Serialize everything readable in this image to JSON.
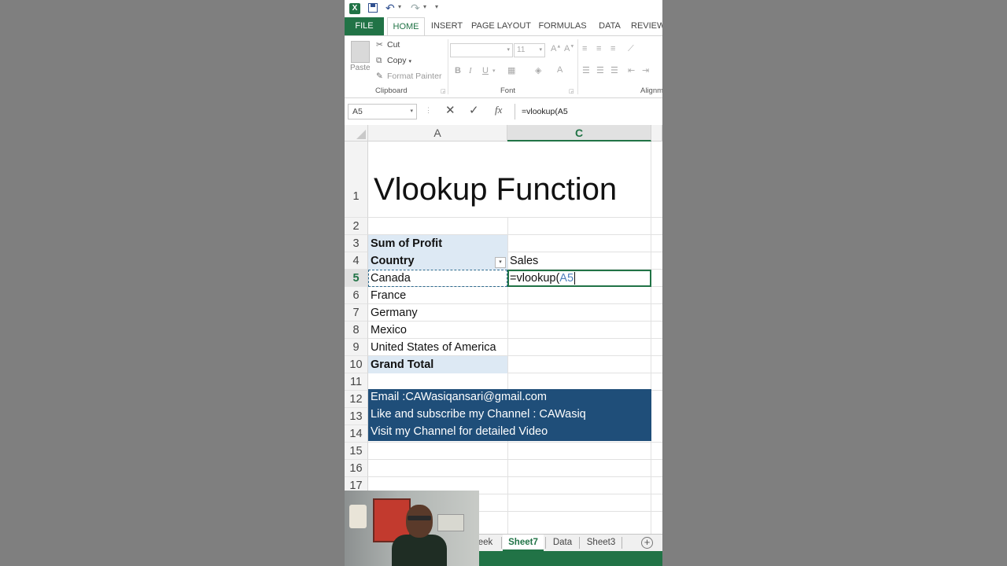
{
  "qat": {
    "app_icon": "X"
  },
  "ribbon_tabs": [
    "FILE",
    "HOME",
    "INSERT",
    "PAGE LAYOUT",
    "FORMULAS",
    "DATA",
    "REVIEW"
  ],
  "clipboard": {
    "paste": "Paste",
    "cut": "Cut",
    "copy": "Copy",
    "format_painter": "Format Painter",
    "label": "Clipboard"
  },
  "font_group": {
    "size": "11",
    "label": "Font"
  },
  "alignment_group": {
    "label": "Alignment"
  },
  "formula_bar": {
    "name_box": "A5",
    "formula": "=vlookup(A5"
  },
  "columns": [
    "A",
    "C"
  ],
  "rows": [
    "1",
    "2",
    "3",
    "4",
    "5",
    "6",
    "7",
    "8",
    "9",
    "10",
    "11",
    "12",
    "13",
    "14",
    "15",
    "16",
    "17"
  ],
  "cells": {
    "title": "Vlookup Function",
    "a3": "Sum of Profit",
    "a4": "Country",
    "c4": "Sales",
    "a5": "Canada",
    "c5_prefix": "=vlookup(",
    "c5_ref": "A5",
    "a6": "France",
    "a7": "Germany",
    "a8": "Mexico",
    "a9": "United States of America",
    "a10": "Grand Total",
    "a12": "Email :CAWasiqansari@gmail.com",
    "a13": "Like and subscribe my Channel : CAWasiq",
    "a14": "Visit my Channel for detailed Video"
  },
  "sheet_tabs": [
    "eek",
    "Sheet7",
    "Data",
    "Sheet3"
  ],
  "active_sheet": "Sheet7",
  "colors": {
    "excel_green": "#217346",
    "pivot_fill": "#dde9f4",
    "info_fill": "#1f4e79",
    "ref_blue": "#4f81bd"
  }
}
